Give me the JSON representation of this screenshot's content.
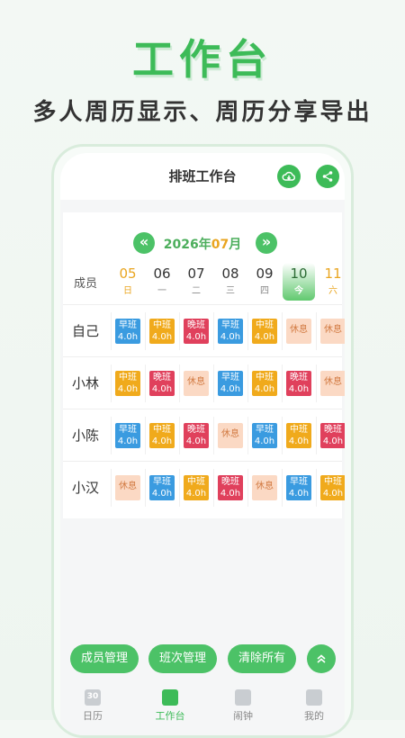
{
  "promo": {
    "title": "工作台",
    "subtitle": "多人周历显示、周历分享导出"
  },
  "topbar": {
    "title": "排班工作台"
  },
  "calendar": {
    "year_prefix": "2026年",
    "month": "07",
    "month_suffix": "月",
    "prev_label": "«",
    "next_label": "»",
    "member_header": "成员",
    "days": [
      {
        "num": "05",
        "wk": "日",
        "kind": "weekend"
      },
      {
        "num": "06",
        "wk": "一",
        "kind": "normal"
      },
      {
        "num": "07",
        "wk": "二",
        "kind": "normal"
      },
      {
        "num": "08",
        "wk": "三",
        "kind": "normal"
      },
      {
        "num": "09",
        "wk": "四",
        "kind": "normal"
      },
      {
        "num": "10",
        "wk": "今",
        "kind": "today"
      },
      {
        "num": "11",
        "wk": "六",
        "kind": "weekend"
      }
    ]
  },
  "shift_colors": {
    "早班": "#3a9be0",
    "中班": "#f0aa1c",
    "晚班": "#e0405c",
    "休息": "#fbd9c4"
  },
  "members": [
    {
      "name": "自己",
      "shifts": [
        {
          "name": "早班",
          "hours": "4.0h"
        },
        {
          "name": "中班",
          "hours": "4.0h"
        },
        {
          "name": "晚班",
          "hours": "4.0h"
        },
        {
          "name": "早班",
          "hours": "4.0h"
        },
        {
          "name": "中班",
          "hours": "4.0h"
        },
        {
          "name": "休息",
          "hours": ""
        },
        {
          "name": "休息",
          "hours": ""
        }
      ]
    },
    {
      "name": "小林",
      "shifts": [
        {
          "name": "中班",
          "hours": "4.0h"
        },
        {
          "name": "晚班",
          "hours": "4.0h"
        },
        {
          "name": "休息",
          "hours": ""
        },
        {
          "name": "早班",
          "hours": "4.0h"
        },
        {
          "name": "中班",
          "hours": "4.0h"
        },
        {
          "name": "晚班",
          "hours": "4.0h"
        },
        {
          "name": "休息",
          "hours": ""
        }
      ]
    },
    {
      "name": "小陈",
      "shifts": [
        {
          "name": "早班",
          "hours": "4.0h"
        },
        {
          "name": "中班",
          "hours": "4.0h"
        },
        {
          "name": "晚班",
          "hours": "4.0h"
        },
        {
          "name": "休息",
          "hours": ""
        },
        {
          "name": "早班",
          "hours": "4.0h"
        },
        {
          "name": "中班",
          "hours": "4.0h"
        },
        {
          "name": "晚班",
          "hours": "4.0h"
        }
      ]
    },
    {
      "name": "小汉",
      "shifts": [
        {
          "name": "休息",
          "hours": ""
        },
        {
          "name": "早班",
          "hours": "4.0h"
        },
        {
          "name": "中班",
          "hours": "4.0h"
        },
        {
          "name": "晚班",
          "hours": "4.0h"
        },
        {
          "name": "休息",
          "hours": ""
        },
        {
          "name": "早班",
          "hours": "4.0h"
        },
        {
          "name": "中班",
          "hours": "4.0h"
        }
      ]
    }
  ],
  "actions": {
    "members": "成员管理",
    "shifts": "班次管理",
    "clear": "清除所有",
    "collapse_icon": "chevron-up-icon"
  },
  "tabs": [
    {
      "label": "日历",
      "icon": "calendar-icon",
      "badge": "30",
      "active": false
    },
    {
      "label": "工作台",
      "icon": "workbench-icon",
      "badge": "",
      "active": true
    },
    {
      "label": "闹钟",
      "icon": "alarm-icon",
      "badge": "",
      "active": false
    },
    {
      "label": "我的",
      "icon": "user-icon",
      "badge": "",
      "active": false
    }
  ]
}
